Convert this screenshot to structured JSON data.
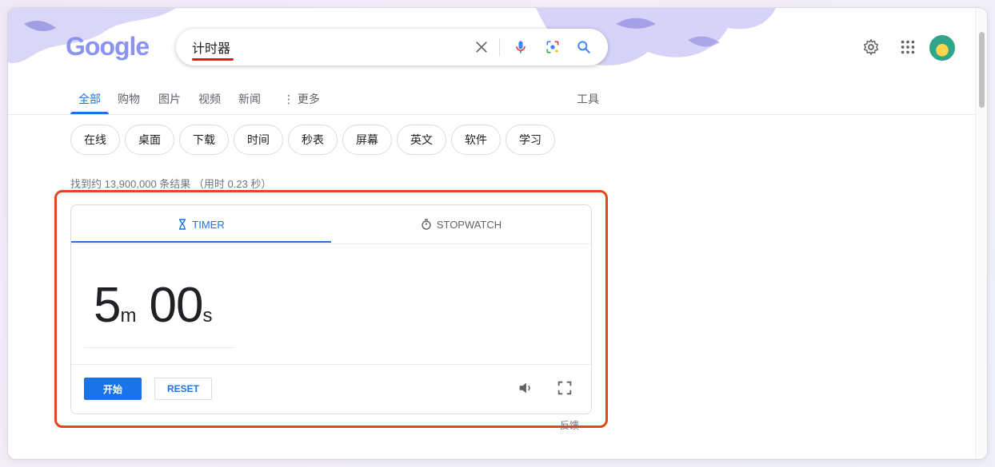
{
  "header": {
    "logo_text": "Google",
    "search": {
      "value": "计时器"
    }
  },
  "nav": {
    "tabs": [
      "全部",
      "购物",
      "图片",
      "视频",
      "新闻",
      "⋮ 更多"
    ],
    "tools": "工具"
  },
  "chips": [
    "在线",
    "桌面",
    "下载",
    "时间",
    "秒表",
    "屏幕",
    "英文",
    "软件",
    "学习"
  ],
  "result_stats": "找到约 13,900,000 条结果 （用时 0.23 秒）",
  "timer_card": {
    "tabs": {
      "timer": "TIMER",
      "stopwatch": "STOPWATCH"
    },
    "minutes": "5",
    "minutes_unit": "m",
    "seconds": "00",
    "seconds_unit": "s",
    "start_label": "开始",
    "reset_label": "RESET"
  },
  "feedback": "反馈",
  "colors": {
    "accent": "#1a73e8",
    "highlight_box": "#e4471f",
    "search_underline": "#e8141b"
  }
}
